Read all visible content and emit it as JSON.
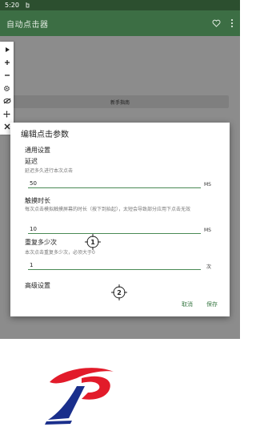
{
  "status_bar": {
    "time": "5:20"
  },
  "app_bar": {
    "title": "自动点击器",
    "icons": [
      "heart-icon",
      "menu-dots-icon"
    ]
  },
  "background": {
    "guide_button_label": "新手指南"
  },
  "toolbar": {
    "icons": [
      "play-icon",
      "add-icon",
      "remove-icon",
      "settings-icon",
      "hide-icon",
      "move-icon",
      "close-icon"
    ]
  },
  "dialog": {
    "title": "编辑点击参数",
    "section_general": "通用设置",
    "delay": {
      "title": "延迟",
      "desc": "延迟多久进行本次点击",
      "value": "50",
      "unit": "MS"
    },
    "touch_duration": {
      "title": "触摸时长",
      "desc": "每次点击模拟触摸屏幕的时长（按下到抬起），太短会导致部分应用下点击无效",
      "value": "10",
      "unit": "MS"
    },
    "repeat": {
      "title": "重复多少次",
      "desc": "本次点击重复多少次，必须大于0",
      "value": "1",
      "unit": "次"
    },
    "section_advanced": "高级设置",
    "cancel_label": "取消",
    "save_label": "保存"
  },
  "markers": [
    {
      "label": "1"
    },
    {
      "label": "2"
    }
  ],
  "colors": {
    "app_bar": "#3c6e44",
    "status_bar": "#2c4f2f",
    "accent": "#3b7a46",
    "logo_red": "#e21b2a",
    "logo_blue": "#1a2f8c"
  }
}
